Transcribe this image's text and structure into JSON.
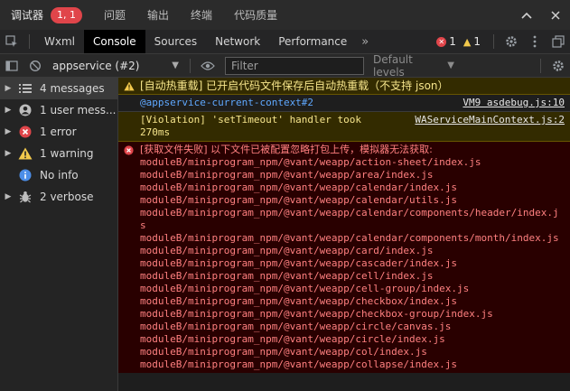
{
  "top": {
    "tabs": [
      {
        "label": "调试器",
        "active": true
      },
      {
        "label": "问题"
      },
      {
        "label": "输出"
      },
      {
        "label": "终端"
      },
      {
        "label": "代码质量"
      }
    ],
    "badge": "1, 1"
  },
  "devtools": {
    "tabs": [
      "Wxml",
      "Console",
      "Sources",
      "Network",
      "Performance"
    ],
    "active_tab": "Console",
    "more": "»",
    "error_count": "1",
    "warning_count": "1"
  },
  "console_bar": {
    "context": "appservice (#2)",
    "filter_placeholder": "Filter",
    "levels": "Default levels"
  },
  "sidebar": {
    "items": [
      {
        "label": "4 messages",
        "icon": "list-icon"
      },
      {
        "label": "1 user mess...",
        "icon": "user-icon"
      },
      {
        "label": "1 error",
        "icon": "error-icon"
      },
      {
        "label": "1 warning",
        "icon": "warning-icon"
      },
      {
        "label": "No info",
        "icon": "info-icon"
      },
      {
        "label": "2 verbose",
        "icon": "bug-icon"
      }
    ]
  },
  "messages": {
    "warn1": "[自动热重载] 已开启代码文件保存后自动热重载（不支持 json）",
    "context_line": "@appservice-current-context#2",
    "context_src": "VM9 asdebug.js:10",
    "violation_text": "[Violation] 'setTimeout' handler took 270ms",
    "violation_src": "WAServiceMainContext.js:2",
    "error_title": "[获取文件失败] 以下文件已被配置忽略打包上传，模拟器无法获取:",
    "error_paths": [
      "moduleB/miniprogram_npm/@vant/weapp/action-sheet/index.js",
      "moduleB/miniprogram_npm/@vant/weapp/area/index.js",
      "moduleB/miniprogram_npm/@vant/weapp/calendar/index.js",
      "moduleB/miniprogram_npm/@vant/weapp/calendar/utils.js",
      "moduleB/miniprogram_npm/@vant/weapp/calendar/components/header/index.js",
      "moduleB/miniprogram_npm/@vant/weapp/calendar/components/month/index.js",
      "moduleB/miniprogram_npm/@vant/weapp/card/index.js",
      "moduleB/miniprogram_npm/@vant/weapp/cascader/index.js",
      "moduleB/miniprogram_npm/@vant/weapp/cell/index.js",
      "moduleB/miniprogram_npm/@vant/weapp/cell-group/index.js",
      "moduleB/miniprogram_npm/@vant/weapp/checkbox/index.js",
      "moduleB/miniprogram_npm/@vant/weapp/checkbox-group/index.js",
      "moduleB/miniprogram_npm/@vant/weapp/circle/canvas.js",
      "moduleB/miniprogram_npm/@vant/weapp/circle/index.js",
      "moduleB/miniprogram_npm/@vant/weapp/col/index.js",
      "moduleB/miniprogram_npm/@vant/weapp/collapse/index.js"
    ]
  },
  "colors": {
    "error": "#e0454a",
    "warning": "#f2c94c",
    "link": "#5fa8ff"
  }
}
